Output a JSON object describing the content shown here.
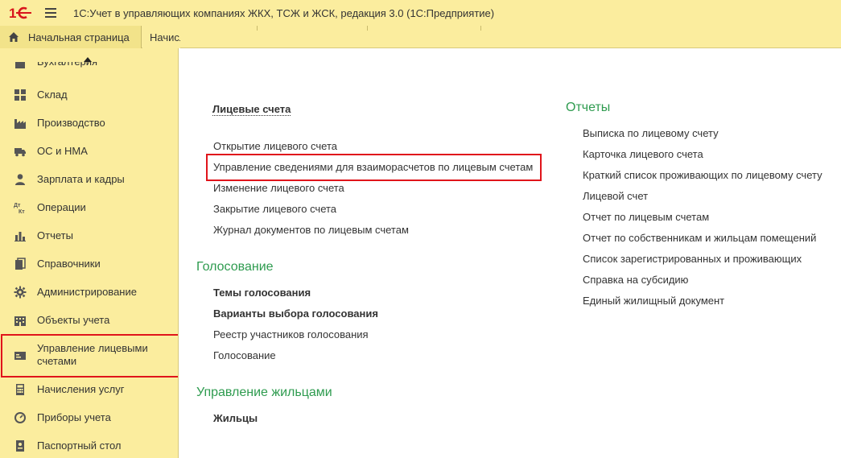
{
  "app": {
    "title": "1С:Учет в управляющих компаниях ЖКХ, ТСЖ и ЖСК, редакция 3.0  (1С:Предприятие)"
  },
  "tabs": [
    {
      "label": "Начальная страница",
      "icon": "home-icon"
    },
    {
      "label": "Начисл"
    }
  ],
  "sidebar": {
    "partial_label": "Бухгалтерия",
    "items": [
      {
        "label": "Склад",
        "icon": "grid-icon"
      },
      {
        "label": "Производство",
        "icon": "factory-icon"
      },
      {
        "label": "ОС и НМА",
        "icon": "truck-icon"
      },
      {
        "label": "Зарплата и кадры",
        "icon": "person-icon"
      },
      {
        "label": "Операции",
        "icon": "dt-kt-icon"
      },
      {
        "label": "Отчеты",
        "icon": "bar-chart-icon"
      },
      {
        "label": "Справочники",
        "icon": "books-icon"
      },
      {
        "label": "Администрирование",
        "icon": "gear-icon"
      },
      {
        "label": "Объекты учета",
        "icon": "building-icon"
      },
      {
        "label": "Управление лицевыми счетами",
        "label_line1": "Управление лицевыми",
        "label_line2": "счетами",
        "icon": "card-icon"
      },
      {
        "label": "Начисления услуг",
        "icon": "calculator-icon"
      },
      {
        "label": "Приборы учета",
        "icon": "meter-icon"
      },
      {
        "label": "Паспортный стол",
        "icon": "passport-icon"
      }
    ]
  },
  "content": {
    "accounts": {
      "title": "Лицевые счета",
      "links": [
        "Открытие лицевого счета",
        "Управление сведениями для взаиморасчетов по лицевым счетам",
        "Изменение лицевого счета",
        "Закрытие лицевого счета",
        "Журнал документов по лицевым счетам"
      ]
    },
    "voting": {
      "title": "Голосование",
      "links": [
        "Темы голосования",
        "Варианты выбора голосования",
        "Реестр участников голосования",
        "Голосование"
      ]
    },
    "residents": {
      "title": "Управление жильцами",
      "links": [
        "Жильцы"
      ]
    },
    "reports": {
      "title": "Отчеты",
      "links": [
        "Выписка по лицевому счету",
        "Карточка лицевого счета",
        "Краткий список проживающих по лицевому счету",
        "Лицевой счет",
        "Отчет по лицевым счетам",
        "Отчет по собственникам и жильцам помещений",
        "Список зарегистрированных и проживающих",
        "Справка на субсидию",
        "Единый жилищный документ"
      ]
    }
  },
  "colors": {
    "panel": "#fbed9e",
    "section_title": "#2e9b4f",
    "highlight": "#e0141b",
    "logo": "#d8161c"
  }
}
